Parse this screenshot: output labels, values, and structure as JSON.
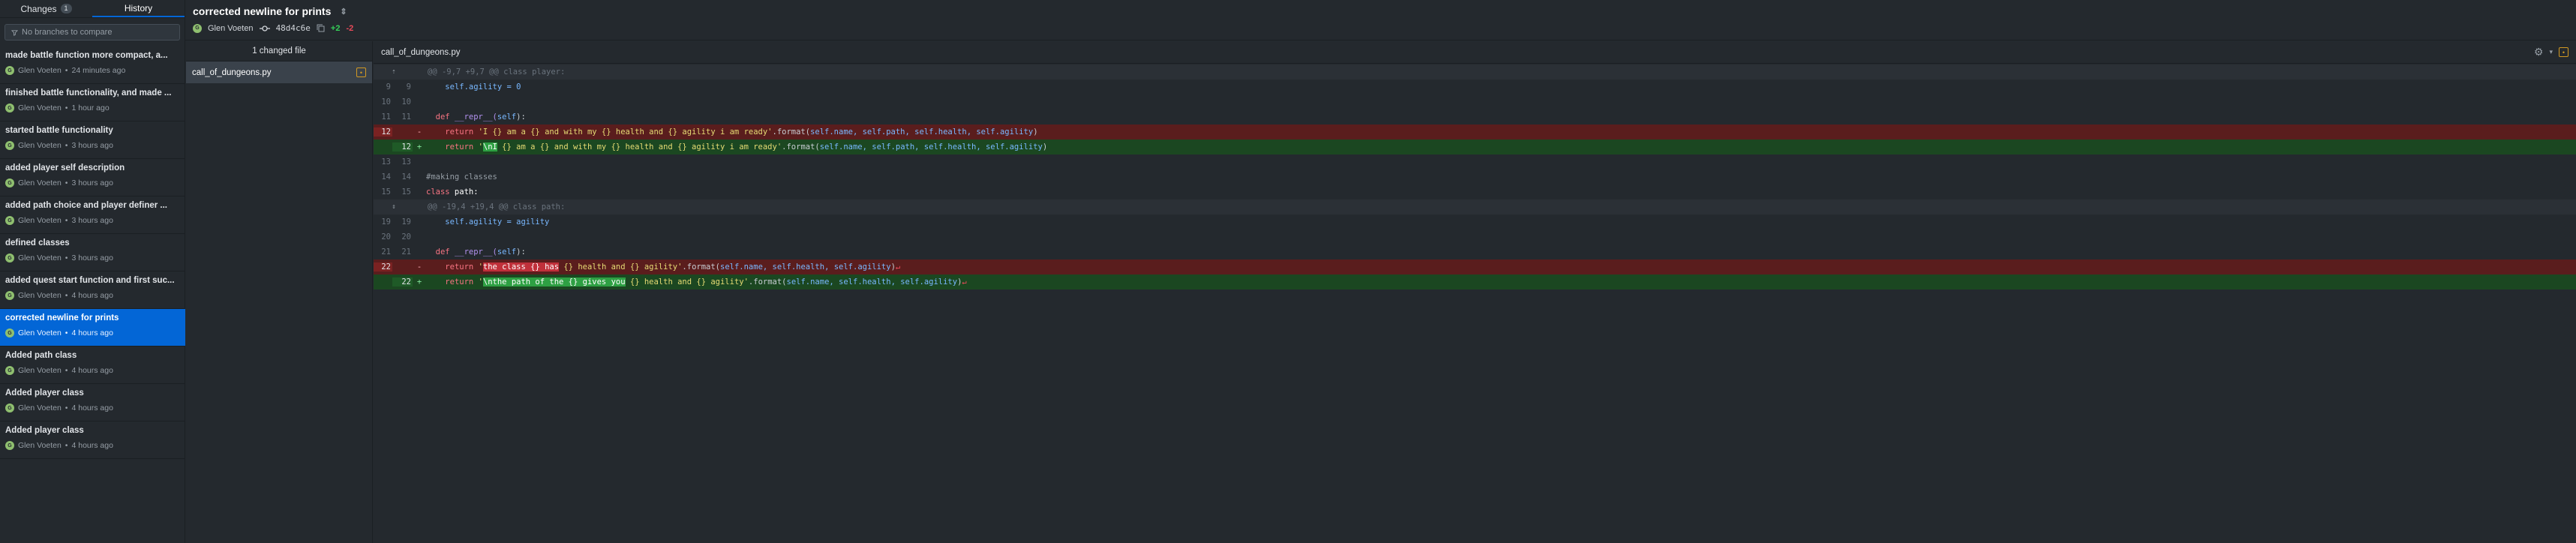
{
  "tabs": {
    "changes_label": "Changes",
    "changes_count": "1",
    "history_label": "History"
  },
  "branch_filter": {
    "placeholder": "No branches to compare"
  },
  "commits": [
    {
      "title": "made battle function more compact, a...",
      "author": "Glen Voeten",
      "time": "24 minutes ago"
    },
    {
      "title": "finished battle functionality, and made ...",
      "author": "Glen Voeten",
      "time": "1 hour ago"
    },
    {
      "title": "started battle functionality",
      "author": "Glen Voeten",
      "time": "3 hours ago"
    },
    {
      "title": "added player self description",
      "author": "Glen Voeten",
      "time": "3 hours ago"
    },
    {
      "title": "added path choice and player definer ...",
      "author": "Glen Voeten",
      "time": "3 hours ago"
    },
    {
      "title": "defined classes",
      "author": "Glen Voeten",
      "time": "3 hours ago"
    },
    {
      "title": "added quest start function and first suc...",
      "author": "Glen Voeten",
      "time": "4 hours ago"
    },
    {
      "title": "corrected newline for prints",
      "author": "Glen Voeten",
      "time": "4 hours ago"
    },
    {
      "title": "Added path class",
      "author": "Glen Voeten",
      "time": "4 hours ago"
    },
    {
      "title": "Added player class",
      "author": "Glen Voeten",
      "time": "4 hours ago"
    },
    {
      "title": "Added player class",
      "author": "Glen Voeten",
      "time": "4 hours ago"
    }
  ],
  "selected_commit": {
    "summary": "corrected newline for prints",
    "author": "Glen Voeten",
    "sha": "48d4c6e",
    "additions": "+2",
    "deletions": "-2"
  },
  "files": {
    "count_label": "1 changed file",
    "items": [
      {
        "name": "call_of_dungeons.py"
      }
    ]
  },
  "diff": {
    "filename": "call_of_dungeons.py",
    "hunk1": "@@ -9,7 +9,7 @@ class player:",
    "hunk2": "@@ -19,4 +19,4 @@ class path:",
    "lines": [
      {
        "old": "9",
        "new": "9"
      },
      {
        "old": "10",
        "new": "10"
      },
      {
        "old": "11",
        "new": "11"
      },
      {
        "old": "12",
        "new": ""
      },
      {
        "old": "",
        "new": "12"
      },
      {
        "old": "13",
        "new": "13"
      },
      {
        "old": "14",
        "new": "14"
      },
      {
        "old": "15",
        "new": "15"
      },
      {
        "old": "19",
        "new": "19"
      },
      {
        "old": "20",
        "new": "20"
      },
      {
        "old": "21",
        "new": "21"
      },
      {
        "old": "22",
        "new": ""
      },
      {
        "old": "",
        "new": "22"
      }
    ],
    "code": {
      "l9": "self.agility = 0",
      "l11_def": "def",
      "l11_rest": " __repr__(",
      "l11_self": "self",
      "l11_end": "):",
      "l12_ret": "return",
      "l12_str_a": "'I {} am a {} and with my {} health and {} agility i am ready'",
      "l12_fmt": ".format(",
      "l12_args": "self.name, self.path, self.health, self.agility",
      "l12_close": ")",
      "l12n_str_pre": "'",
      "l12n_hl": "\\nI",
      "l12n_str_post": " {} am a {} and with my {} health and {} agility i am ready'",
      "l14": "#making classes",
      "l15_kw": "class",
      "l15_rest": " path:",
      "l19": "self.agility = agility",
      "l22_str_pre": "'",
      "l22_hl": "the class {} has",
      "l22_str_post": " {} health and {} agility'",
      "l22_args": "self.name, self.health, self.agility",
      "l22n_hl": "\\nthe path of the {} gives you",
      "l22n_str_post": " {} health and {} agility'",
      "eol": "↵"
    }
  },
  "icons": {
    "filter": "filter-icon",
    "settings": "gear-icon",
    "expand": "unfold-icon",
    "commit": "git-commit-icon",
    "copy": "copy-icon"
  },
  "colors": {
    "accent": "#0366d6",
    "deletion_bg": "#5a1d1d",
    "addition_bg": "#1b4721"
  }
}
